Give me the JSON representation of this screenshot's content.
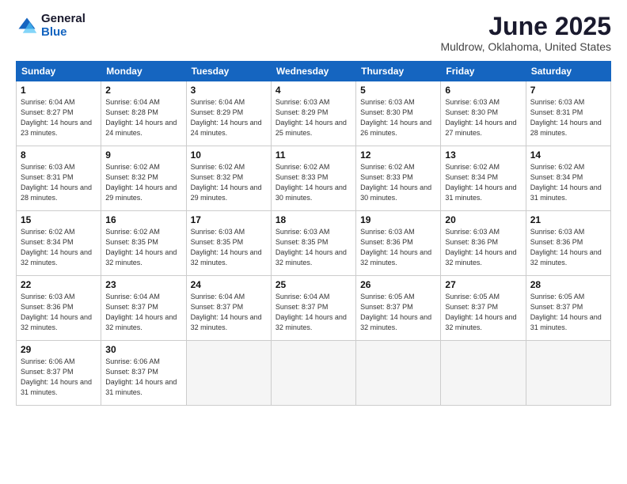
{
  "header": {
    "logo_general": "General",
    "logo_blue": "Blue",
    "main_title": "June 2025",
    "sub_title": "Muldrow, Oklahoma, United States"
  },
  "calendar": {
    "days_of_week": [
      "Sunday",
      "Monday",
      "Tuesday",
      "Wednesday",
      "Thursday",
      "Friday",
      "Saturday"
    ],
    "weeks": [
      [
        {
          "day": "1",
          "sunrise": "6:04 AM",
          "sunset": "8:27 PM",
          "daylight": "14 hours and 23 minutes."
        },
        {
          "day": "2",
          "sunrise": "6:04 AM",
          "sunset": "8:28 PM",
          "daylight": "14 hours and 24 minutes."
        },
        {
          "day": "3",
          "sunrise": "6:04 AM",
          "sunset": "8:29 PM",
          "daylight": "14 hours and 24 minutes."
        },
        {
          "day": "4",
          "sunrise": "6:03 AM",
          "sunset": "8:29 PM",
          "daylight": "14 hours and 25 minutes."
        },
        {
          "day": "5",
          "sunrise": "6:03 AM",
          "sunset": "8:30 PM",
          "daylight": "14 hours and 26 minutes."
        },
        {
          "day": "6",
          "sunrise": "6:03 AM",
          "sunset": "8:30 PM",
          "daylight": "14 hours and 27 minutes."
        },
        {
          "day": "7",
          "sunrise": "6:03 AM",
          "sunset": "8:31 PM",
          "daylight": "14 hours and 28 minutes."
        }
      ],
      [
        {
          "day": "8",
          "sunrise": "6:03 AM",
          "sunset": "8:31 PM",
          "daylight": "14 hours and 28 minutes."
        },
        {
          "day": "9",
          "sunrise": "6:02 AM",
          "sunset": "8:32 PM",
          "daylight": "14 hours and 29 minutes."
        },
        {
          "day": "10",
          "sunrise": "6:02 AM",
          "sunset": "8:32 PM",
          "daylight": "14 hours and 29 minutes."
        },
        {
          "day": "11",
          "sunrise": "6:02 AM",
          "sunset": "8:33 PM",
          "daylight": "14 hours and 30 minutes."
        },
        {
          "day": "12",
          "sunrise": "6:02 AM",
          "sunset": "8:33 PM",
          "daylight": "14 hours and 30 minutes."
        },
        {
          "day": "13",
          "sunrise": "6:02 AM",
          "sunset": "8:34 PM",
          "daylight": "14 hours and 31 minutes."
        },
        {
          "day": "14",
          "sunrise": "6:02 AM",
          "sunset": "8:34 PM",
          "daylight": "14 hours and 31 minutes."
        }
      ],
      [
        {
          "day": "15",
          "sunrise": "6:02 AM",
          "sunset": "8:34 PM",
          "daylight": "14 hours and 32 minutes."
        },
        {
          "day": "16",
          "sunrise": "6:02 AM",
          "sunset": "8:35 PM",
          "daylight": "14 hours and 32 minutes."
        },
        {
          "day": "17",
          "sunrise": "6:03 AM",
          "sunset": "8:35 PM",
          "daylight": "14 hours and 32 minutes."
        },
        {
          "day": "18",
          "sunrise": "6:03 AM",
          "sunset": "8:35 PM",
          "daylight": "14 hours and 32 minutes."
        },
        {
          "day": "19",
          "sunrise": "6:03 AM",
          "sunset": "8:36 PM",
          "daylight": "14 hours and 32 minutes."
        },
        {
          "day": "20",
          "sunrise": "6:03 AM",
          "sunset": "8:36 PM",
          "daylight": "14 hours and 32 minutes."
        },
        {
          "day": "21",
          "sunrise": "6:03 AM",
          "sunset": "8:36 PM",
          "daylight": "14 hours and 32 minutes."
        }
      ],
      [
        {
          "day": "22",
          "sunrise": "6:03 AM",
          "sunset": "8:36 PM",
          "daylight": "14 hours and 32 minutes."
        },
        {
          "day": "23",
          "sunrise": "6:04 AM",
          "sunset": "8:37 PM",
          "daylight": "14 hours and 32 minutes."
        },
        {
          "day": "24",
          "sunrise": "6:04 AM",
          "sunset": "8:37 PM",
          "daylight": "14 hours and 32 minutes."
        },
        {
          "day": "25",
          "sunrise": "6:04 AM",
          "sunset": "8:37 PM",
          "daylight": "14 hours and 32 minutes."
        },
        {
          "day": "26",
          "sunrise": "6:05 AM",
          "sunset": "8:37 PM",
          "daylight": "14 hours and 32 minutes."
        },
        {
          "day": "27",
          "sunrise": "6:05 AM",
          "sunset": "8:37 PM",
          "daylight": "14 hours and 32 minutes."
        },
        {
          "day": "28",
          "sunrise": "6:05 AM",
          "sunset": "8:37 PM",
          "daylight": "14 hours and 31 minutes."
        }
      ],
      [
        {
          "day": "29",
          "sunrise": "6:06 AM",
          "sunset": "8:37 PM",
          "daylight": "14 hours and 31 minutes."
        },
        {
          "day": "30",
          "sunrise": "6:06 AM",
          "sunset": "8:37 PM",
          "daylight": "14 hours and 31 minutes."
        },
        null,
        null,
        null,
        null,
        null
      ]
    ]
  }
}
